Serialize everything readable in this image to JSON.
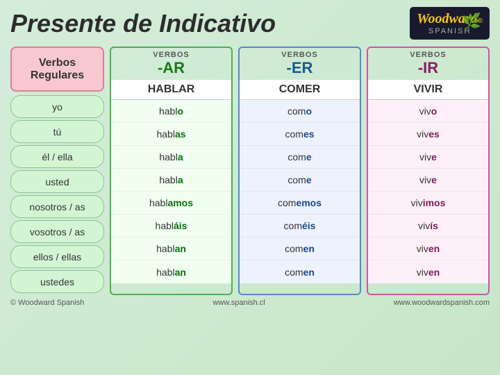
{
  "title": "Presente de Indicativo",
  "logo": {
    "name": "Woodward",
    "reg": "®",
    "spanish": "SPANISH"
  },
  "pronoun_header": "Verbos\nRegulares",
  "pronouns": [
    "yo",
    "tú",
    "él / ella",
    "usted",
    "nosotros / as",
    "vosotros / as",
    "ellos / ellas",
    "ustedes"
  ],
  "ar_col": {
    "verbos_label": "VERBOS",
    "ending": "-AR",
    "verb": "HABLAR",
    "forms": [
      {
        "stem": "habl",
        "ending": "o"
      },
      {
        "stem": "habl",
        "ending": "as"
      },
      {
        "stem": "habl",
        "ending": "a"
      },
      {
        "stem": "habl",
        "ending": "a"
      },
      {
        "stem": "habl",
        "ending": "amos"
      },
      {
        "stem": "habl",
        "ending": "áis"
      },
      {
        "stem": "habl",
        "ending": "an"
      },
      {
        "stem": "habl",
        "ending": "an"
      }
    ]
  },
  "er_col": {
    "verbos_label": "VERBOS",
    "ending": "-ER",
    "verb": "COMER",
    "forms": [
      {
        "stem": "com",
        "ending": "o"
      },
      {
        "stem": "com",
        "ending": "es"
      },
      {
        "stem": "com",
        "ending": "e"
      },
      {
        "stem": "com",
        "ending": "e"
      },
      {
        "stem": "com",
        "ending": "emos"
      },
      {
        "stem": "com",
        "ending": "éis"
      },
      {
        "stem": "com",
        "ending": "en"
      },
      {
        "stem": "com",
        "ending": "en"
      }
    ]
  },
  "ir_col": {
    "verbos_label": "VERBOS",
    "ending": "-IR",
    "verb": "VIVIR",
    "forms": [
      {
        "stem": "viv",
        "ending": "o"
      },
      {
        "stem": "viv",
        "ending": "es"
      },
      {
        "stem": "viv",
        "ending": "e"
      },
      {
        "stem": "viv",
        "ending": "e"
      },
      {
        "stem": "viv",
        "ending": "imos"
      },
      {
        "stem": "viv",
        "ending": "ís"
      },
      {
        "stem": "viv",
        "ending": "en"
      },
      {
        "stem": "viv",
        "ending": "en"
      }
    ]
  },
  "footer": {
    "copyright": "© Woodward Spanish",
    "website1": "www.spanish.cl",
    "website2": "www.woodwardspanish.com"
  }
}
